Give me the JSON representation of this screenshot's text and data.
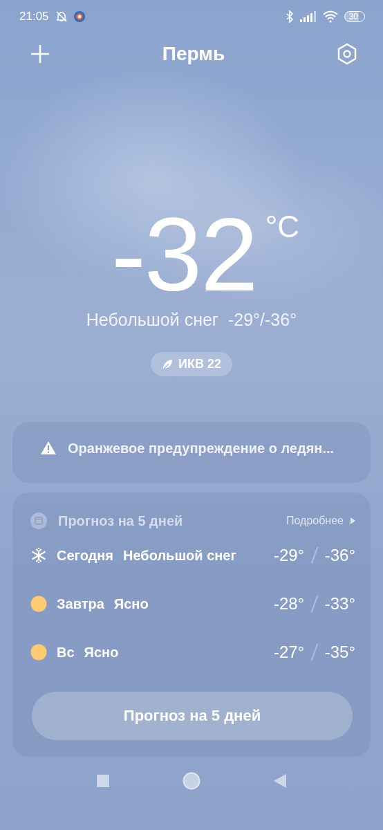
{
  "status_bar": {
    "time": "21:05",
    "battery": "30"
  },
  "header": {
    "city": "Пермь"
  },
  "current": {
    "temperature": "-32",
    "unit": "°C",
    "condition": "Небольшой снег",
    "range": "-29°/-36°",
    "aqi": "ИКВ 22"
  },
  "alert": {
    "text": "Оранжевое предупреждение о ледян..."
  },
  "forecast": {
    "title": "Прогноз на 5 дней",
    "more": "Подробнее",
    "days": [
      {
        "day": "Сегодня",
        "condition": "Небольшой снег",
        "kind": "snow",
        "high": "-29°",
        "low": "-36°"
      },
      {
        "day": "Завтра",
        "condition": "Ясно",
        "kind": "sun",
        "high": "-28°",
        "low": "-33°"
      },
      {
        "day": "Вс",
        "condition": "Ясно",
        "kind": "sun",
        "high": "-27°",
        "low": "-35°"
      }
    ],
    "button": "Прогноз на 5 дней"
  }
}
